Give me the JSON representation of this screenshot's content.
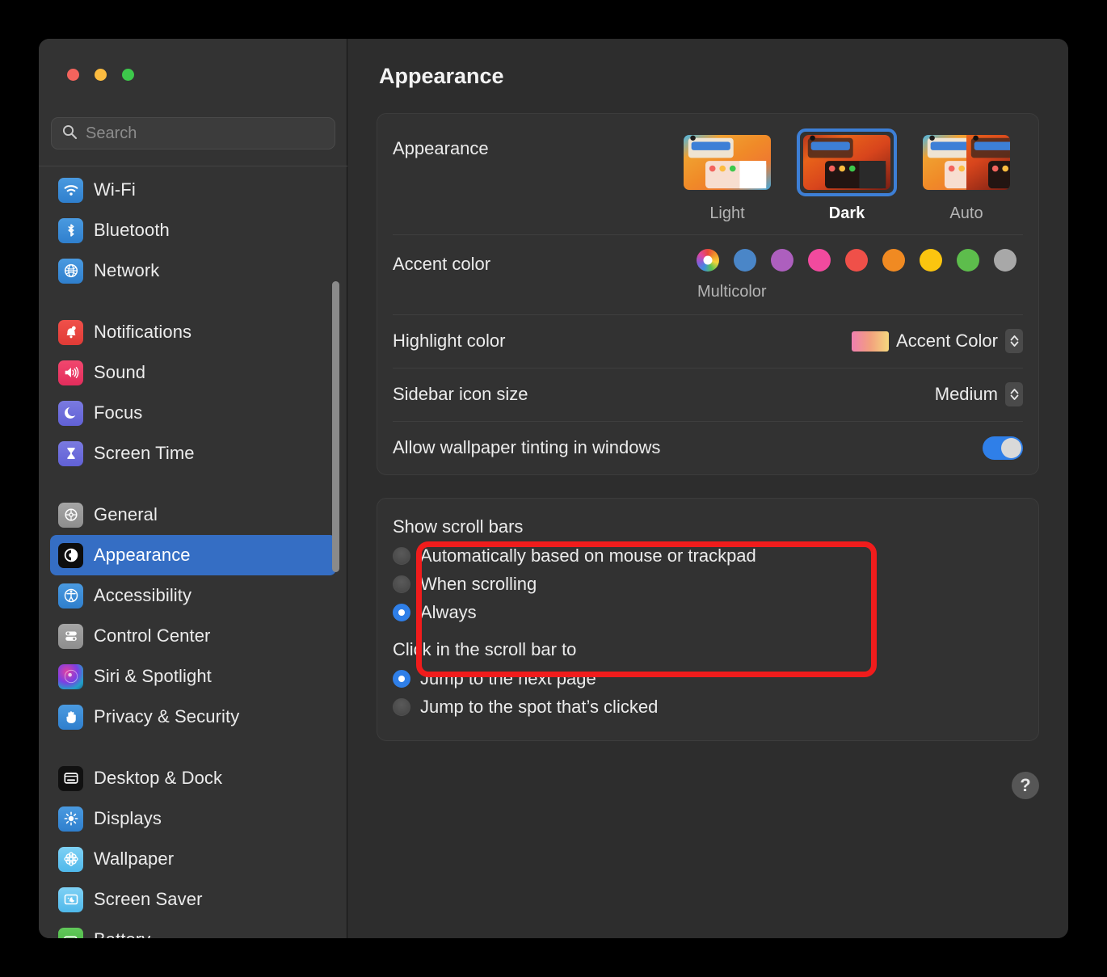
{
  "window": {
    "traffic_lights": [
      {
        "name": "close",
        "color": "#f2645d"
      },
      {
        "name": "minimize",
        "color": "#fcbc40"
      },
      {
        "name": "zoom",
        "color": "#3dc84b"
      }
    ]
  },
  "search": {
    "placeholder": "Search",
    "value": "",
    "icon": "search-icon"
  },
  "sidebar": {
    "groups": [
      {
        "items": [
          {
            "label": "Wi-Fi",
            "icon": "wifi-icon",
            "icon_class": "ic-wifi",
            "selected": false
          },
          {
            "label": "Bluetooth",
            "icon": "bluetooth-icon",
            "icon_class": "ic-bluetooth",
            "selected": false
          },
          {
            "label": "Network",
            "icon": "network-globe-icon",
            "icon_class": "ic-network",
            "selected": false
          }
        ]
      },
      {
        "items": [
          {
            "label": "Notifications",
            "icon": "bell-icon",
            "icon_class": "ic-notif",
            "selected": false
          },
          {
            "label": "Sound",
            "icon": "speaker-icon",
            "icon_class": "ic-sound",
            "selected": false
          },
          {
            "label": "Focus",
            "icon": "moon-icon",
            "icon_class": "ic-focus",
            "selected": false
          },
          {
            "label": "Screen Time",
            "icon": "hourglass-icon",
            "icon_class": "ic-screentime",
            "selected": false
          }
        ]
      },
      {
        "items": [
          {
            "label": "General",
            "icon": "gear-icon",
            "icon_class": "ic-general",
            "selected": false
          },
          {
            "label": "Appearance",
            "icon": "appearance-contrast-icon",
            "icon_class": "ic-appearance",
            "selected": true
          },
          {
            "label": "Accessibility",
            "icon": "accessibility-icon",
            "icon_class": "ic-access",
            "selected": false
          },
          {
            "label": "Control Center",
            "icon": "sliders-icon",
            "icon_class": "ic-control",
            "selected": false
          },
          {
            "label": "Siri & Spotlight",
            "icon": "siri-orb-icon",
            "icon_class": "ic-siri",
            "selected": false
          },
          {
            "label": "Privacy & Security",
            "icon": "hand-icon",
            "icon_class": "ic-privacy",
            "selected": false
          }
        ]
      },
      {
        "items": [
          {
            "label": "Desktop & Dock",
            "icon": "desktop-window-icon",
            "icon_class": "ic-desktop",
            "selected": false
          },
          {
            "label": "Displays",
            "icon": "brightness-sun-icon",
            "icon_class": "ic-displays",
            "selected": false
          },
          {
            "label": "Wallpaper",
            "icon": "flower-icon",
            "icon_class": "ic-wallpaper",
            "selected": false
          },
          {
            "label": "Screen Saver",
            "icon": "screensaver-icon",
            "icon_class": "ic-saver",
            "selected": false
          },
          {
            "label": "Battery",
            "icon": "battery-icon",
            "icon_class": "ic-battery",
            "selected": false
          }
        ]
      }
    ]
  },
  "main": {
    "title": "Appearance",
    "appearance": {
      "label": "Appearance",
      "themes": [
        {
          "name": "Light",
          "selected": false
        },
        {
          "name": "Dark",
          "selected": true
        },
        {
          "name": "Auto",
          "selected": false
        }
      ]
    },
    "accent": {
      "label": "Accent color",
      "caption": "Multicolor",
      "swatches": [
        {
          "name": "multicolor",
          "color": "multicolor",
          "selected": true
        },
        {
          "name": "blue",
          "color": "#4a86c8"
        },
        {
          "name": "purple",
          "color": "#ad5fbe"
        },
        {
          "name": "pink",
          "color": "#f24a9e"
        },
        {
          "name": "red",
          "color": "#ef5049"
        },
        {
          "name": "orange",
          "color": "#f08a22"
        },
        {
          "name": "yellow",
          "color": "#fbc50f"
        },
        {
          "name": "green",
          "color": "#5dbd4c"
        },
        {
          "name": "graphite",
          "color": "#a8a8a8"
        }
      ]
    },
    "highlight": {
      "label": "Highlight color",
      "value": "Accent Color"
    },
    "sidebar_icon_size": {
      "label": "Sidebar icon size",
      "value": "Medium"
    },
    "wallpaper_tinting": {
      "label": "Allow wallpaper tinting in windows",
      "enabled": true
    },
    "scroll_bars": {
      "title": "Show scroll bars",
      "options": [
        {
          "label": "Automatically based on mouse or trackpad",
          "selected": false
        },
        {
          "label": "When scrolling",
          "selected": false
        },
        {
          "label": "Always",
          "selected": true
        }
      ]
    },
    "scroll_click": {
      "title": "Click in the scroll bar to",
      "options": [
        {
          "label": "Jump to the next page",
          "selected": true
        },
        {
          "label": "Jump to the spot that’s clicked",
          "selected": false
        }
      ]
    },
    "help": {
      "label": "?"
    }
  },
  "annotation": {
    "color": "#f01c1c",
    "target": "show-scroll-bars-group"
  }
}
